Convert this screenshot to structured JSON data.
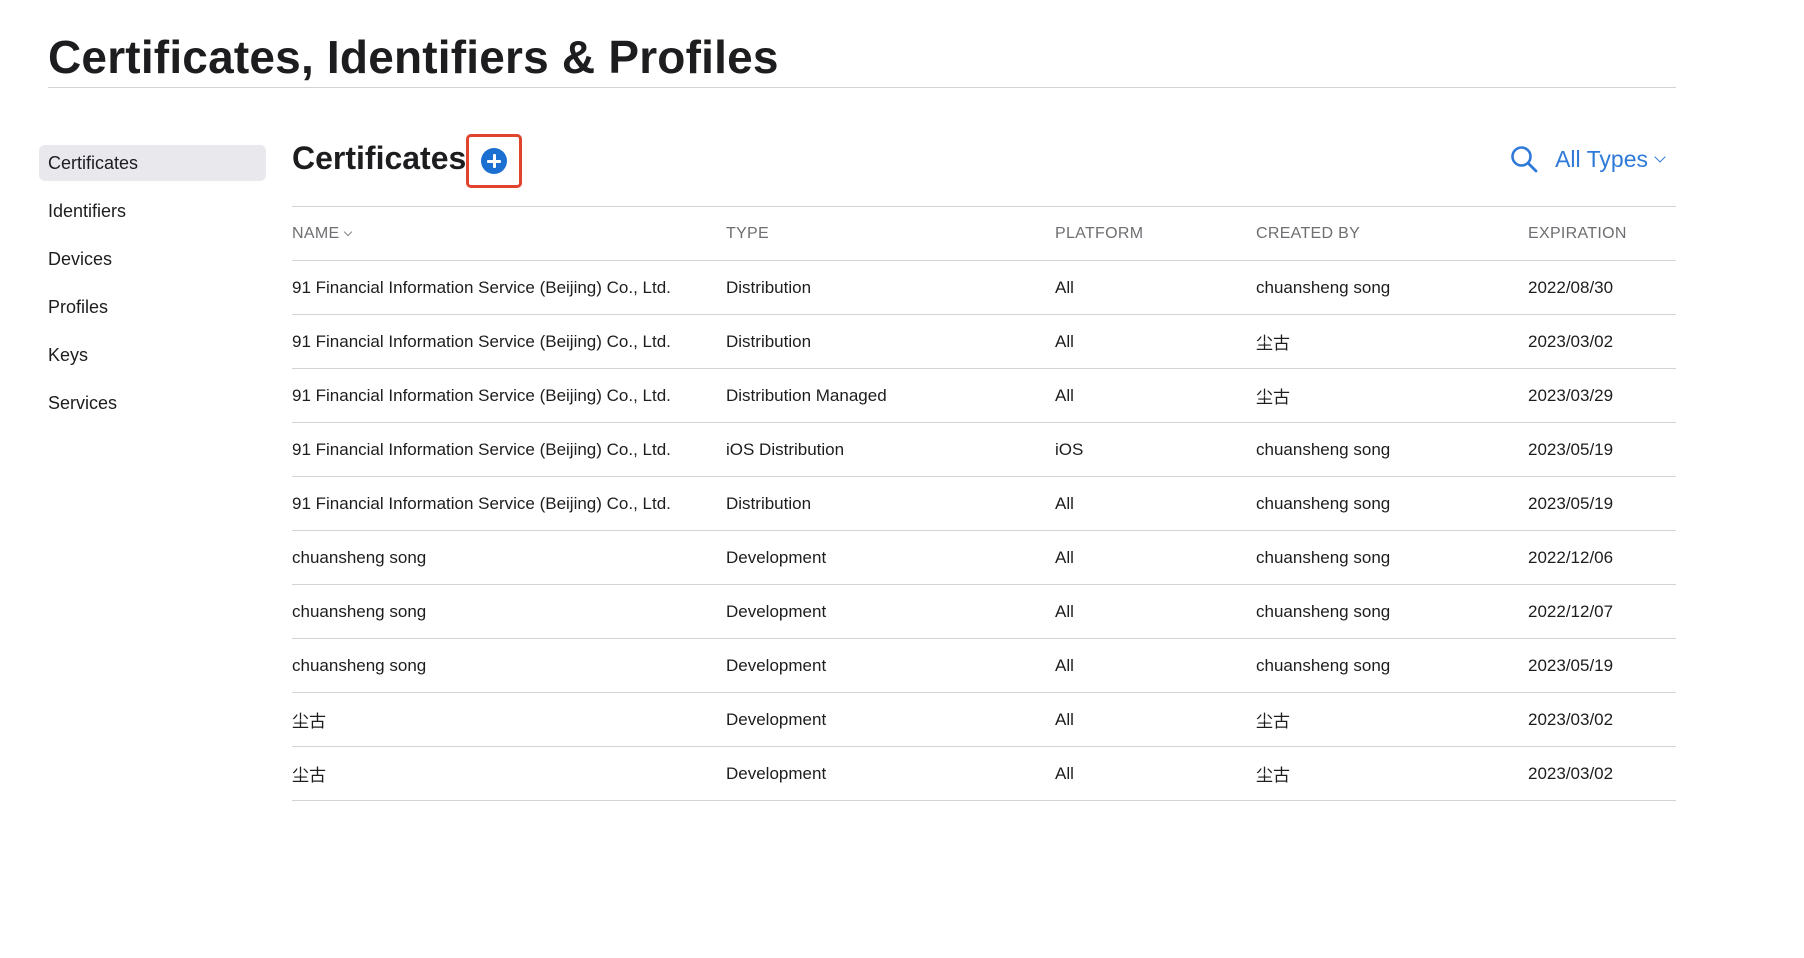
{
  "page": {
    "title": "Certificates, Identifiers & Profiles"
  },
  "sidebar": {
    "items": [
      {
        "label": "Certificates",
        "active": true
      },
      {
        "label": "Identifiers",
        "active": false
      },
      {
        "label": "Devices",
        "active": false
      },
      {
        "label": "Profiles",
        "active": false
      },
      {
        "label": "Keys",
        "active": false
      },
      {
        "label": "Services",
        "active": false
      }
    ]
  },
  "main": {
    "section_title": "Certificates",
    "add_icon": "plus-circle-icon",
    "search_icon": "search-icon",
    "filter_label": "All Types",
    "accent_color": "#1a6fd1",
    "highlight_color": "#e0442c"
  },
  "table": {
    "headers": {
      "name": "NAME",
      "type": "TYPE",
      "platform": "PLATFORM",
      "created_by": "CREATED BY",
      "expiration": "EXPIRATION"
    },
    "rows": [
      {
        "name": "91 Financial Information Service (Beijing) Co., Ltd.",
        "type": "Distribution",
        "platform": "All",
        "created_by": "chuansheng song",
        "expiration": "2022/08/30"
      },
      {
        "name": "91 Financial Information Service (Beijing) Co., Ltd.",
        "type": "Distribution",
        "platform": "All",
        "created_by": "尘古",
        "expiration": "2023/03/02"
      },
      {
        "name": "91 Financial Information Service (Beijing) Co., Ltd.",
        "type": "Distribution Managed",
        "platform": "All",
        "created_by": "尘古",
        "expiration": "2023/03/29"
      },
      {
        "name": "91 Financial Information Service (Beijing) Co., Ltd.",
        "type": "iOS Distribution",
        "platform": "iOS",
        "created_by": "chuansheng song",
        "expiration": "2023/05/19"
      },
      {
        "name": "91 Financial Information Service (Beijing) Co., Ltd.",
        "type": "Distribution",
        "platform": "All",
        "created_by": "chuansheng song",
        "expiration": "2023/05/19"
      },
      {
        "name": "chuansheng song",
        "type": "Development",
        "platform": "All",
        "created_by": "chuansheng song",
        "expiration": "2022/12/06"
      },
      {
        "name": "chuansheng song",
        "type": "Development",
        "platform": "All",
        "created_by": "chuansheng song",
        "expiration": "2022/12/07"
      },
      {
        "name": "chuansheng song",
        "type": "Development",
        "platform": "All",
        "created_by": "chuansheng song",
        "expiration": "2023/05/19"
      },
      {
        "name": "尘古",
        "type": "Development",
        "platform": "All",
        "created_by": "尘古",
        "expiration": "2023/03/02"
      },
      {
        "name": "尘古",
        "type": "Development",
        "platform": "All",
        "created_by": "尘古",
        "expiration": "2023/03/02"
      }
    ]
  }
}
